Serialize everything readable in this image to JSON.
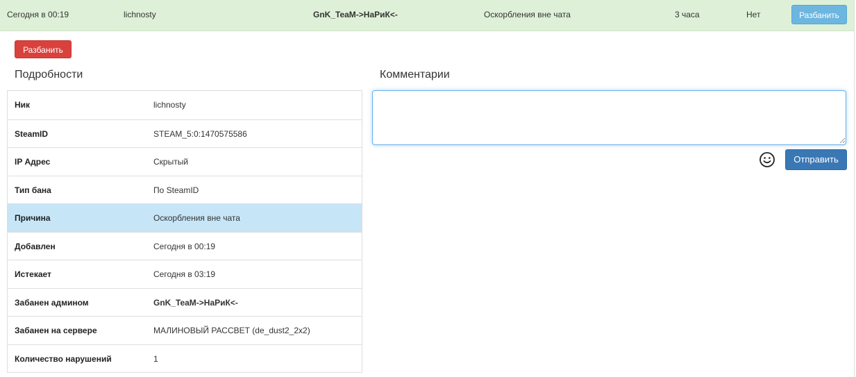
{
  "ban_row": {
    "date": "Сегодня в 00:19",
    "nick": "lichnosty",
    "admin": "GnK_TeaM->НаРиК<-",
    "reason": "Оскорбления вне чата",
    "duration": "3 часа",
    "status": "Нет",
    "unban_label": "Разбанить"
  },
  "actions": {
    "unban_label": "Разбанить"
  },
  "details": {
    "heading": "Подробности",
    "rows": [
      {
        "key": "Ник",
        "value": "lichnosty"
      },
      {
        "key": "SteamID",
        "value": "STEAM_5:0:1470575586"
      },
      {
        "key": "IP Адрес",
        "value": "Скрытый"
      },
      {
        "key": "Тип бана",
        "value": "По SteamID"
      },
      {
        "key": "Причина",
        "value": "Оскорбления вне чата"
      },
      {
        "key": "Добавлен",
        "value": "Сегодня в 00:19"
      },
      {
        "key": "Истекает",
        "value": "Сегодня в 03:19"
      },
      {
        "key": "Забанен админом",
        "value": "GnK_TeaM->НаРиК<-"
      },
      {
        "key": "Забанен на сервере",
        "value": "МАЛИНОВЫЙ РАССВЕТ (de_dust2_2x2)"
      },
      {
        "key": "Количество нарушений",
        "value": "1"
      }
    ]
  },
  "comments": {
    "heading": "Комментарии",
    "input_value": "",
    "send_label": "Отправить",
    "emoji_icon": "smiley-icon"
  },
  "colors": {
    "row_success_bg": "#dff0d8",
    "highlight_row_bg": "#c6e6f8",
    "danger_button": "#d9413c",
    "primary_button": "#3a78b5",
    "info_button": "#6cb6e0"
  }
}
